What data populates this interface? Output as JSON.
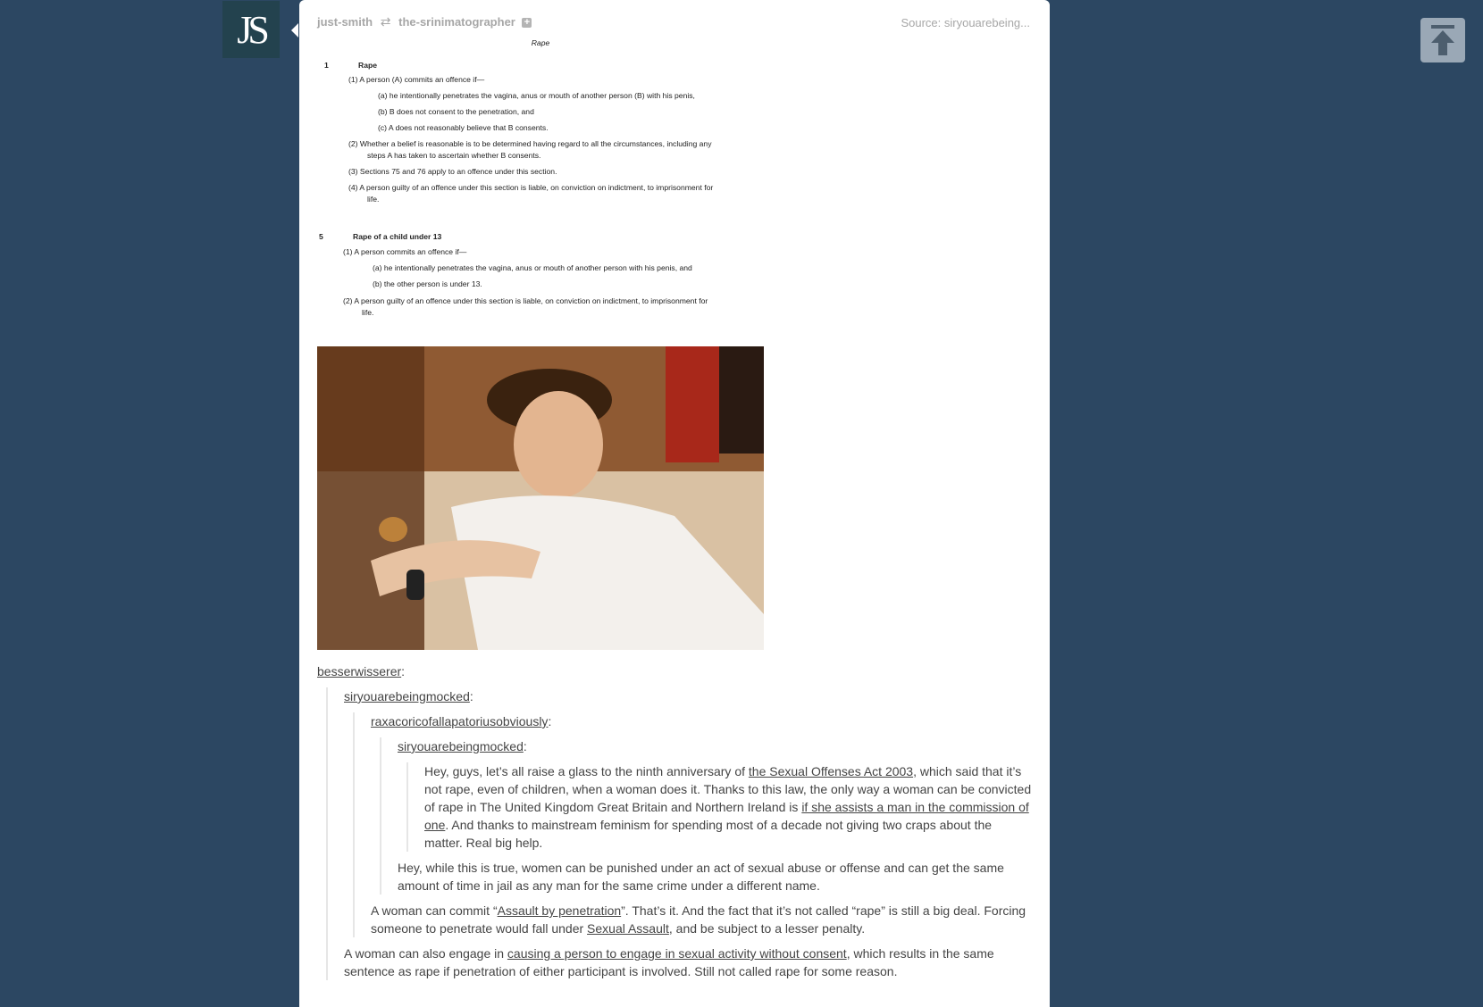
{
  "avatar": {
    "initials": "JS"
  },
  "header": {
    "blog": "just-smith",
    "reblogged_from": "the-srinimatographer",
    "source": "Source: siryouarebeing..."
  },
  "document": {
    "title": "Rape",
    "lines": [
      {
        "text": "1",
        "bold": true
      },
      {
        "text": "Rape",
        "bold": true
      },
      {
        "text": "(1)   A person (A) commits an offence if—"
      },
      {
        "text": "(a)   he intentionally penetrates the vagina, anus or mouth of another person (B) with his penis,"
      },
      {
        "text": "(b)   B does not consent to the penetration, and"
      },
      {
        "text": "(c)   A does not reasonably believe that B consents."
      },
      {
        "text": "(2)   Whether a belief is reasonable is to be determined having regard to all the circumstances, including any"
      },
      {
        "text": "steps A has taken to ascertain whether B consents."
      },
      {
        "text": "(3)   Sections 75 and 76 apply to an offence under this section."
      },
      {
        "text": "(4)   A person guilty of an offence under this section is liable, on conviction on indictment, to imprisonment for"
      },
      {
        "text": "life."
      },
      {
        "text": "5",
        "bold": true
      },
      {
        "text": "Rape of a child under 13",
        "bold": true
      },
      {
        "text": "(1)   A person commits an offence if—"
      },
      {
        "text": "(a)   he intentionally penetrates the vagina, anus or mouth of another person with his penis, and"
      },
      {
        "text": "(b)   the other person is under 13."
      },
      {
        "text": "(2)   A person guilty of an offence under this section is liable, on conviction on indictment, to imprisonment for"
      },
      {
        "text": "life."
      }
    ]
  },
  "thread": {
    "u1": "besserwisserer",
    "u2": "siryouarebeingmocked",
    "u3": "raxacoricofallapatoriusobviously",
    "u4": "siryouarebeingmocked",
    "p4": {
      "a": "Hey, guys, let’s all raise a glass to the ninth anniversary of ",
      "link1": "the Sexual Offenses Act 2003",
      "b": ", which said that it’s not rape, even of children, when a woman does it. Thanks to this law, the only way a woman can be convicted of rape in The United Kingdom Great Britain and Northern Ireland is ",
      "link2": "if she assists a man in the commission of one",
      "c": ". And thanks to mainstream feminism for spending most of a decade not giving two craps about the matter. Real big help."
    },
    "p3": "Hey, while this is true, women can be punished under an act of sexual abuse or offense and can get the same amount of time in jail as any man for the same crime under a different name.",
    "p2": {
      "a": "A woman can commit “",
      "link1": "Assault by penetration",
      "b": "”. That’s it. And the fact that it’s not called “rape” is still a big deal. Forcing someone to penetrate would fall under ",
      "link2": "Sexual Assault",
      "c": ", and be subject to a lesser penalty."
    },
    "p1": {
      "a": "A woman can also engage in ",
      "link1": "causing a person to engage in sexual activity without consent",
      "b": ", which results in the same sentence as rape if penetration of either participant is involved. Still not called rape for some reason."
    }
  }
}
